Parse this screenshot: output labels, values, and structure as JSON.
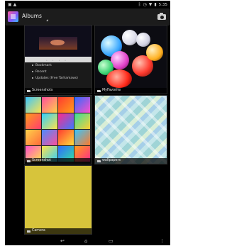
{
  "status_bar": {
    "left_icons": [
      "android-icon",
      "warning-icon"
    ],
    "time": "5:35",
    "right_icons": [
      "bluetooth-icon",
      "alarm-icon",
      "wifi-icon",
      "battery-icon"
    ]
  },
  "action_bar": {
    "title": "Albums",
    "camera_icon": "camera-icon"
  },
  "albums": [
    {
      "name": "Screenshots",
      "list_items": [
        "Bookmark",
        "Recent",
        "Updates (Free Tarhamaws)"
      ]
    },
    {
      "name": "MyFavorite"
    },
    {
      "name": "Screenshot"
    },
    {
      "name": "wallpapers"
    },
    {
      "name": "Camera"
    }
  ],
  "navigation": {
    "back_icon": "back-icon",
    "home_icon": "home-icon",
    "recents_icon": "recents-icon",
    "menu_icon": "overflow-menu-icon"
  },
  "colors": {
    "camera_album": "#d7c43b",
    "action_bar": "#1c1c1c",
    "background": "#000000"
  }
}
